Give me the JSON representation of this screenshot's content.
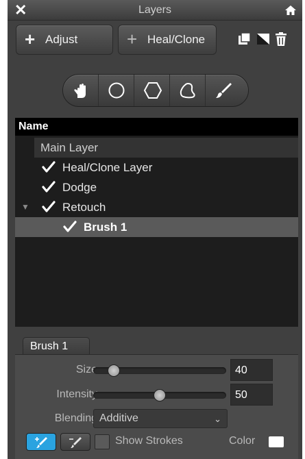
{
  "window": {
    "title": "Layers",
    "close_glyph": "✕",
    "home_icon": "home-icon"
  },
  "toolbar_buttons": {
    "adjust": {
      "plus": "+",
      "label": "Adjust"
    },
    "heal_clone": {
      "plus": "+",
      "label": "Heal/Clone"
    }
  },
  "layer_actions": [
    "duplicate-layer-icon",
    "mask-icon",
    "trash-icon"
  ],
  "tools": [
    "hand-icon",
    "ellipse-icon",
    "polygon-icon",
    "lasso-icon",
    "brush-icon"
  ],
  "layers": {
    "header": "Name",
    "main_layer": "Main Layer",
    "items": [
      {
        "label": "Heal/Clone Layer",
        "checked": true
      },
      {
        "label": "Dodge",
        "checked": true
      },
      {
        "label": "Retouch",
        "checked": true,
        "expanded": true
      },
      {
        "label": "Brush 1",
        "checked": true,
        "selected": true
      }
    ]
  },
  "brush": {
    "tab": "Brush 1",
    "size_label": "Size",
    "size_value": "40",
    "size_fraction": 0.12,
    "intensity_label": "Intensity",
    "intensity_value": "50",
    "intensity_fraction": 0.5,
    "blending_label": "Blending",
    "blending_value": "Additive",
    "show_strokes_label": "Show Strokes",
    "show_strokes_checked": false,
    "color_label": "Color",
    "color_value": "#ffffff"
  },
  "colors": {
    "accent": "#2aa3e0",
    "panel": "#404040",
    "list_bg": "#1d1d1d",
    "selected_row": "#5a5a5a"
  }
}
